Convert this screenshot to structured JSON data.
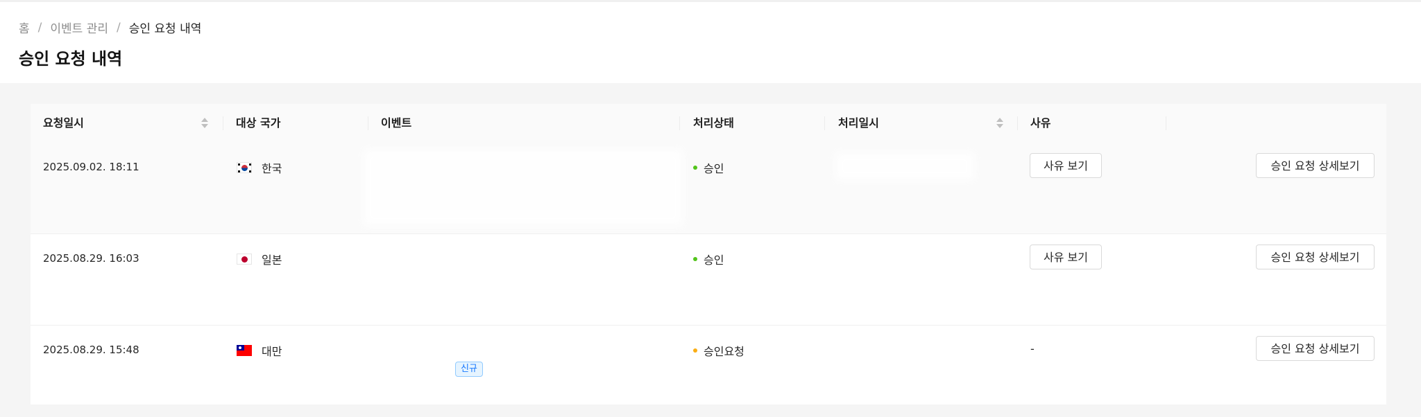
{
  "breadcrumb": {
    "home": "홈",
    "separator": "/",
    "section": "이벤트 관리",
    "current": "승인 요청 내역"
  },
  "page_title": "승인 요청 내역",
  "table": {
    "columns": {
      "requested_at": "요청일시",
      "country": "대상 국가",
      "event": "이벤트",
      "status": "처리상태",
      "processed_at": "처리일시",
      "reason": "사유"
    },
    "rows": [
      {
        "requested_at": "2025.09.02. 18:11",
        "country": "한국",
        "flag_icon": "flag-kr-icon",
        "status": "승인",
        "status_color": "#52c41a",
        "reason_button": "사유 보기",
        "detail_button": "승인 요청 상세보기"
      },
      {
        "requested_at": "2025.08.29. 16:03",
        "country": "일본",
        "flag_icon": "flag-jp-icon",
        "status": "승인",
        "status_color": "#52c41a",
        "reason_button": "사유 보기",
        "detail_button": "승인 요청 상세보기"
      },
      {
        "requested_at": "2025.08.29. 15:48",
        "country": "대만",
        "flag_icon": "flag-tw-icon",
        "status": "승인요청",
        "status_color": "#faad14",
        "event_badge": "신규",
        "reason": "-",
        "detail_button": "승인 요청 상세보기"
      }
    ]
  }
}
